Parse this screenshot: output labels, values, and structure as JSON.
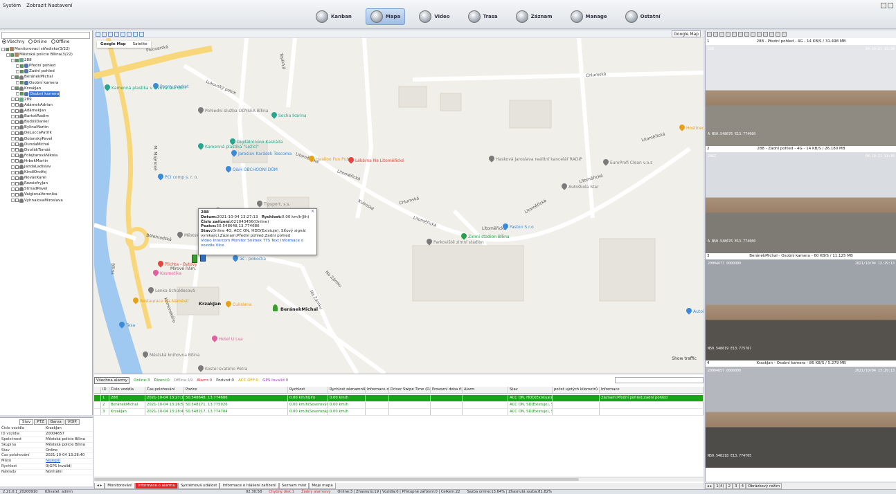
{
  "menu": {
    "items": [
      "Systém",
      "Zobrazit Nastavení"
    ]
  },
  "nav": {
    "items": [
      {
        "label": "Kanban",
        "active": false
      },
      {
        "label": "Mapa",
        "active": true
      },
      {
        "label": "Video",
        "active": false
      },
      {
        "label": "Trasa",
        "active": false
      },
      {
        "label": "Záznam",
        "active": false
      },
      {
        "label": "Manage",
        "active": false
      },
      {
        "label": "Ostatní",
        "active": false
      }
    ]
  },
  "tree": {
    "filters": {
      "all": "Všechny",
      "online": "Online",
      "offline": "Offline"
    },
    "rows": [
      {
        "indent": 0,
        "label": "Monitorovací středisko(3/22)",
        "icon": "grp"
      },
      {
        "indent": 1,
        "label": "Městská policie Bílina(3/22)",
        "icon": "grp"
      },
      {
        "indent": 2,
        "label": "288",
        "icon": "car"
      },
      {
        "indent": 3,
        "label": "Přední pohled",
        "icon": "cam"
      },
      {
        "indent": 3,
        "label": "Zadní pohled",
        "icon": "cam"
      },
      {
        "indent": 2,
        "label": "BeránekMichal",
        "icon": "person"
      },
      {
        "indent": 3,
        "label": "Osobní kamera",
        "icon": "cam"
      },
      {
        "indent": 2,
        "label": "KrzakJan",
        "icon": "person"
      },
      {
        "indent": 3,
        "label": "Osobní kamera",
        "icon": "cam",
        "selected": true
      },
      {
        "indent": 2,
        "label": "289",
        "icon": "car"
      },
      {
        "indent": 2,
        "label": "AdámekAdrian",
        "icon": "person"
      },
      {
        "indent": 2,
        "label": "AdámekJan",
        "icon": "person"
      },
      {
        "indent": 2,
        "label": "BartošRadim",
        "icon": "person"
      },
      {
        "indent": 2,
        "label": "BudošDaniel",
        "icon": "person"
      },
      {
        "indent": 2,
        "label": "BylinaMartin",
        "icon": "person"
      },
      {
        "indent": 2,
        "label": "DeLuccaPatrik",
        "icon": "person"
      },
      {
        "indent": 2,
        "label": "DolanskýPavel",
        "icon": "person"
      },
      {
        "indent": 2,
        "label": "DundaMichal",
        "icon": "person"
      },
      {
        "indent": 2,
        "label": "DvořákTomáš",
        "icon": "person"
      },
      {
        "indent": 2,
        "label": "FolejtarováNikola",
        "icon": "person"
      },
      {
        "indent": 2,
        "label": "HrbekMartin",
        "icon": "person"
      },
      {
        "indent": 2,
        "label": "JandaLadislav",
        "icon": "person"
      },
      {
        "indent": 2,
        "label": "KindlOndřej",
        "icon": "person"
      },
      {
        "indent": 2,
        "label": "NovákKarel",
        "icon": "person"
      },
      {
        "indent": 2,
        "label": "RozsiefryJan",
        "icon": "person"
      },
      {
        "indent": 2,
        "label": "StrnadPavel",
        "icon": "person"
      },
      {
        "indent": 2,
        "label": "VaiglovaVeronika",
        "icon": "person"
      },
      {
        "indent": 2,
        "label": "VyhnalovaMiroslava",
        "icon": "person"
      }
    ]
  },
  "props": {
    "tabs": [
      "Stav",
      "PTZ",
      "Barva",
      "VOIP"
    ],
    "rows": [
      {
        "k": "Číslo vozidla",
        "v": "KrzakJan"
      },
      {
        "k": "ID vozidla",
        "v": "20004657"
      },
      {
        "k": "Společnost",
        "v": "Městská policie Bílina"
      },
      {
        "k": "Skupina",
        "v": "Městská policie Bílina"
      },
      {
        "k": "Stav",
        "v": "Online"
      },
      {
        "k": "Čas polohování",
        "v": "2021-10-04 13:28:40"
      },
      {
        "k": "Místo",
        "v": "Nejlepší"
      },
      {
        "k": "Rychlost",
        "v": "0(GPS Invalid)"
      },
      {
        "k": "Náklady",
        "v": "Normální"
      }
    ]
  },
  "map": {
    "type_select": "Google Map",
    "tabs": [
      "Google Map",
      "Satelite"
    ],
    "streets": [
      "Pivovarská",
      "Lukovský potok",
      "Teplická",
      "Chlumská",
      "Litoměřická",
      "Litoměřická",
      "Litoměřická",
      "Litoměřická",
      "Litoměřická",
      "Litoměřická",
      "Litoměřická",
      "Chlumská",
      "Na Zámku",
      "Na Zámku",
      "Bílina",
      "M. Majerové",
      "Kulmská",
      "Komenského",
      "Bělehradská",
      "Mírové nám."
    ],
    "pois": [
      {
        "name": "Penny market",
        "color": "#3b8ad8"
      },
      {
        "name": "Kamenná plastika v Pivovarské ulici",
        "color": "#27a58e"
      },
      {
        "name": "Pohlední služba ODYSEA Bílina",
        "color": "#7a7a7a"
      },
      {
        "name": "Socha Ikarina",
        "color": "#27a58e"
      },
      {
        "name": "Kamenná plastika \"Ležící\"",
        "color": "#27a58e"
      },
      {
        "name": "Digitální kino Kaskáda",
        "color": "#27a58e"
      },
      {
        "name": "Jaroslav Karásek Tescoma",
        "color": "#3b8ad8"
      },
      {
        "name": "Haailoo Fun Pub",
        "color": "#e8a115"
      },
      {
        "name": "Lékárna Na Litoměřické",
        "color": "#e0463e"
      },
      {
        "name": "Hasková Jaroslava realitní kancelář RADIP",
        "color": "#7a7a7a"
      },
      {
        "name": "EuroProfi Clean v.o.s",
        "color": "#7a7a7a"
      },
      {
        "name": "PCI comp s. r. o.",
        "color": "#3b8ad8"
      },
      {
        "name": "Q&H OBCHODNÍ DŮM",
        "color": "#3b8ad8"
      },
      {
        "name": "RODAX, spol. s r.o.",
        "color": "#7a7a7a"
      },
      {
        "name": "Tipsport, s.s.",
        "color": "#7a7a7a"
      },
      {
        "name": "Autoškola Star",
        "color": "#7a7a7a"
      },
      {
        "name": "Městský p",
        "color": "#7a7a7a"
      },
      {
        "name": "Faston S.r.o",
        "color": "#3b8ad8"
      },
      {
        "name": "Zimní stadion Bílina",
        "color": "#27a04a"
      },
      {
        "name": "Parkoviště zimní stadion",
        "color": "#7a7a7a"
      },
      {
        "name": "Plichta - Bytový",
        "color": "#e0463e"
      },
      {
        "name": "Kosmetika",
        "color": "#e060a0"
      },
      {
        "name": "as - pobočka",
        "color": "#3b8ad8"
      },
      {
        "name": "Lenka Schuldesová",
        "color": "#7a7a7a"
      },
      {
        "name": "Restaurace Na Náměstí",
        "color": "#e8a115"
      },
      {
        "name": "Cukrárna",
        "color": "#e8a115"
      },
      {
        "name": "Tesa",
        "color": "#3b8ad8"
      },
      {
        "name": "Hotel U Lva",
        "color": "#e060a0"
      },
      {
        "name": "Městská knihovna Bílina",
        "color": "#7a7a7a"
      },
      {
        "name": "Kostel svatého Petra",
        "color": "#7a7a7a"
      },
      {
        "name": "Hostinec",
        "color": "#e8a115"
      },
      {
        "name": "Autoi",
        "color": "#3b8ad8"
      }
    ],
    "popup": {
      "id": "288",
      "datum_label": "Datum:",
      "datum": "2021-10-04 13:27:13",
      "speed_label": "Rychlost:",
      "speed": "0.00 km/h(Jih)",
      "device_label": "Číslo zařízení:",
      "device": "021043456(Online)",
      "pos_label": "Pozice:",
      "pos": "50.548648,13.774686",
      "stav_label": "Stav:",
      "stav": "Online 4G, ACC ON, HDD(Existuje), Síťový signál vynikající,Záznam:Přední pohled,Zadní pohled",
      "links": "Video  Intercom  Monitor  Snímek  TTS Text  Informace o vozidle  Více",
      "close": "×"
    },
    "vehicles": [
      {
        "label": "KrzakJan"
      },
      {
        "label": "BeránekMichal"
      }
    ],
    "show_traffic": "Show traffic"
  },
  "status": {
    "alarm_select": "Všechna alarmy",
    "online": "Online:3",
    "rizeni": "Řízení:0",
    "offline": "Offline:19",
    "alarm": "Alarm:0",
    "podvod": "Podvod:0",
    "acc_off": "ACC OFF:0",
    "gps_invalid": "GPS Invalid:0"
  },
  "table": {
    "headers": [
      "ID",
      "Číslo vozidla",
      "Čas polohování",
      "Pozice",
      "Rychlost",
      "Rychlost záznamníku",
      "Informace o ř",
      "Driver Swipe Time (Dat)",
      "Provozní doba řidiče",
      "Alarm",
      "Stav",
      "počet ujetých kilometrů",
      "Informace"
    ],
    "rows": [
      {
        "id": "1",
        "vehicle": "288",
        "time": "2021-10-04 13:27:13",
        "pos": "50.548648, 13.774686",
        "speed": "0.00 km/h(Jih)",
        "rec_speed": "0.00 km/h",
        "info": "",
        "swipe": "",
        "drive": "",
        "alarm": "",
        "stav": "ACC ON, HDD(Existuje), S",
        "km": "",
        "informace": "Záznam:Přední pohled,Zadní pohled",
        "selected": true
      },
      {
        "id": "2",
        "vehicle": "BeránekMichal",
        "time": "2021-10-04 13:26:54",
        "pos": "50.548171, 13.775926",
        "speed": "0.00 km/h(Severovýchod)",
        "rec_speed": "0.00 km/h",
        "info": "",
        "swipe": "",
        "drive": "",
        "alarm": "",
        "stav": "ACC ON, SD(Existuje), SIM",
        "km": "",
        "informace": "",
        "selected": false
      },
      {
        "id": "3",
        "vehicle": "KrzakJan",
        "time": "2021-10-04 13:28:40",
        "pos": "50.548217, 13.774704",
        "speed": "0.00 km/h(Severozápad)",
        "rec_speed": "0.00 km/h",
        "info": "",
        "swipe": "",
        "drive": "",
        "alarm": "",
        "stav": "ACC ON, SD(Existuje), SIM",
        "km": "",
        "informace": "",
        "selected": false
      }
    ]
  },
  "bottom_tabs": [
    "Monitorování",
    "Informace o alarmu",
    "Systémová událost",
    "Informace o hlášení zařízení",
    "Seznam míst",
    "Moje mapa"
  ],
  "videos": [
    {
      "num": "1",
      "title": "288 - Přední pohled - 4G - 14 KB/S / 31.498 MB",
      "osd_tl": "288",
      "osd_tr": "04-10-21 13:30",
      "osd_bl": "A N50.548676 E13.774600",
      "sky": "#e4e6ea",
      "ground": "#8f8a82"
    },
    {
      "num": "2",
      "title": "288 - Zadní pohled - 4G - 14 KB/S / 26.180 MB",
      "osd_tl": "288Z",
      "osd_tr": "04-10-21 13:30",
      "osd_bl": "A N50.548676 E13.774600",
      "sky": "#d9dce0",
      "ground": "#7e7b75"
    },
    {
      "num": "3",
      "title": "BeránekMichal - Osobní kamera - 60 KB/S / 11.125 MB",
      "osd_tl": "20004677 0000000",
      "osd_tr": "2021/10/04 13:29:13",
      "osd_bl": "N50.548019 E13.775767",
      "sky": "#9ea3aa",
      "ground": "#55524d"
    },
    {
      "num": "4",
      "title": "KrzakJan - Osobní kamera - 86 KB/S / 5.279 MB",
      "osd_tl": "20004657 0000000",
      "osd_tr": "2021/10/04 13:29:13",
      "osd_bl": "N50.548218 E13.774705",
      "sky": "#b4b8be",
      "ground": "#4e4c49"
    }
  ],
  "video_tabs": [
    "1(4)",
    "2",
    "3",
    "4",
    "Obrázkový režim"
  ],
  "footer": {
    "version": "2.21.0.1_20200910",
    "user": "Uživatel: admin",
    "time": "02:30:58",
    "disk": "Chybný disk:1",
    "alarm": "Žádný alarmový",
    "summary": "Online:3 | Zhasnuto:19 | Vozidla:0 | Přístupné zařízení:0 | Celkem:22",
    "rate": "Sazba online:13.64% | Zhasnutá sazba:81.82%"
  }
}
